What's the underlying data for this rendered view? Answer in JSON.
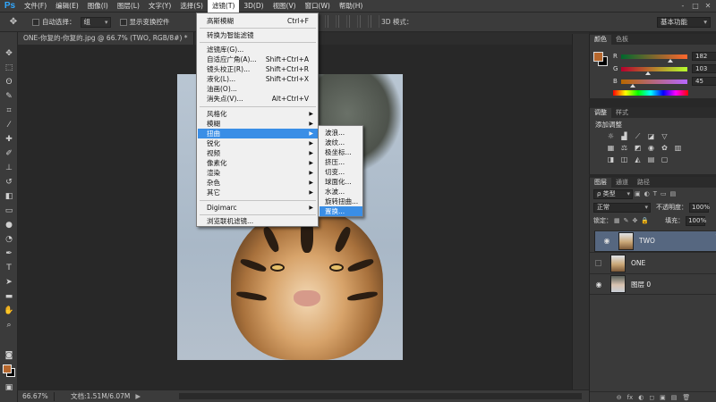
{
  "menubar": {
    "logo": "Ps",
    "items": [
      "文件(F)",
      "编辑(E)",
      "图像(I)",
      "图层(L)",
      "文字(Y)",
      "选择(S)",
      "滤镜(T)",
      "3D(D)",
      "视图(V)",
      "窗口(W)",
      "帮助(H)"
    ],
    "active_index": 6,
    "window_controls": [
      "-",
      "□",
      "✕"
    ]
  },
  "options": {
    "auto_select_label": "自动选择：",
    "auto_select_value": "组",
    "show_transform_label": "显示变换控件",
    "mode_3d_label": "3D 模式：",
    "workspace": "基本功能"
  },
  "document": {
    "tab_active": "ONE-你复的-你复的.jpg @ 66.7% (TWO, RGB/8#) *",
    "tab_inactive": "TV"
  },
  "status": {
    "zoom": "66.67%",
    "doc_info": "文档:1.51M/6.07M",
    "arrow": "▶"
  },
  "filter_menu": {
    "items": [
      {
        "label": "高斯模糊",
        "shortcut": "Ctrl+F"
      },
      {
        "label": "转换为智能滤镜",
        "shortcut": ""
      },
      {
        "label": "滤镜库(G)...",
        "shortcut": ""
      },
      {
        "label": "自适应广角(A)...",
        "shortcut": "Shift+Ctrl+A"
      },
      {
        "label": "镜头校正(R)...",
        "shortcut": "Shift+Ctrl+R"
      },
      {
        "label": "液化(L)...",
        "shortcut": "Shift+Ctrl+X"
      },
      {
        "label": "油画(O)...",
        "shortcut": ""
      },
      {
        "label": "消失点(V)...",
        "shortcut": "Alt+Ctrl+V"
      },
      {
        "label": "风格化",
        "shortcut": ""
      },
      {
        "label": "模糊",
        "shortcut": ""
      },
      {
        "label": "扭曲",
        "shortcut": ""
      },
      {
        "label": "锐化",
        "shortcut": ""
      },
      {
        "label": "视频",
        "shortcut": ""
      },
      {
        "label": "像素化",
        "shortcut": ""
      },
      {
        "label": "渲染",
        "shortcut": ""
      },
      {
        "label": "杂色",
        "shortcut": ""
      },
      {
        "label": "其它",
        "shortcut": ""
      },
      {
        "label": "Digimarc",
        "shortcut": ""
      },
      {
        "label": "浏览联机滤镜...",
        "shortcut": ""
      }
    ],
    "submenu_arrow": "▶"
  },
  "distort_submenu": {
    "items": [
      "波浪...",
      "波纹...",
      "极坐标...",
      "挤压...",
      "切变...",
      "球面化...",
      "水波...",
      "旋转扭曲...",
      "置换..."
    ]
  },
  "color_panel": {
    "tabs": [
      "颜色",
      "色板"
    ],
    "fg_color": "#b6672d",
    "channels": [
      {
        "name": "R",
        "value": "182"
      },
      {
        "name": "G",
        "value": "103"
      },
      {
        "name": "B",
        "value": "45"
      }
    ]
  },
  "adjustments_panel": {
    "tabs": [
      "调整",
      "样式"
    ],
    "title": "添加调整"
  },
  "layers_panel": {
    "tabs": [
      "图层",
      "通道",
      "路径"
    ],
    "kind_label": "ρ 类型",
    "blend_mode": "正常",
    "opacity_label": "不透明度：",
    "opacity_value": "100%",
    "lock_label": "锁定：",
    "fill_label": "填充：",
    "fill_value": "100%",
    "layers": [
      {
        "name": "TWO",
        "visible": true,
        "selected": true
      },
      {
        "name": "ONE",
        "visible": false,
        "selected": false
      },
      {
        "name": "图层 0",
        "visible": true,
        "selected": false
      }
    ],
    "footer_icons": [
      "⊖",
      "fx",
      "◐",
      "◻",
      "▣",
      "▤",
      "🗑"
    ]
  }
}
